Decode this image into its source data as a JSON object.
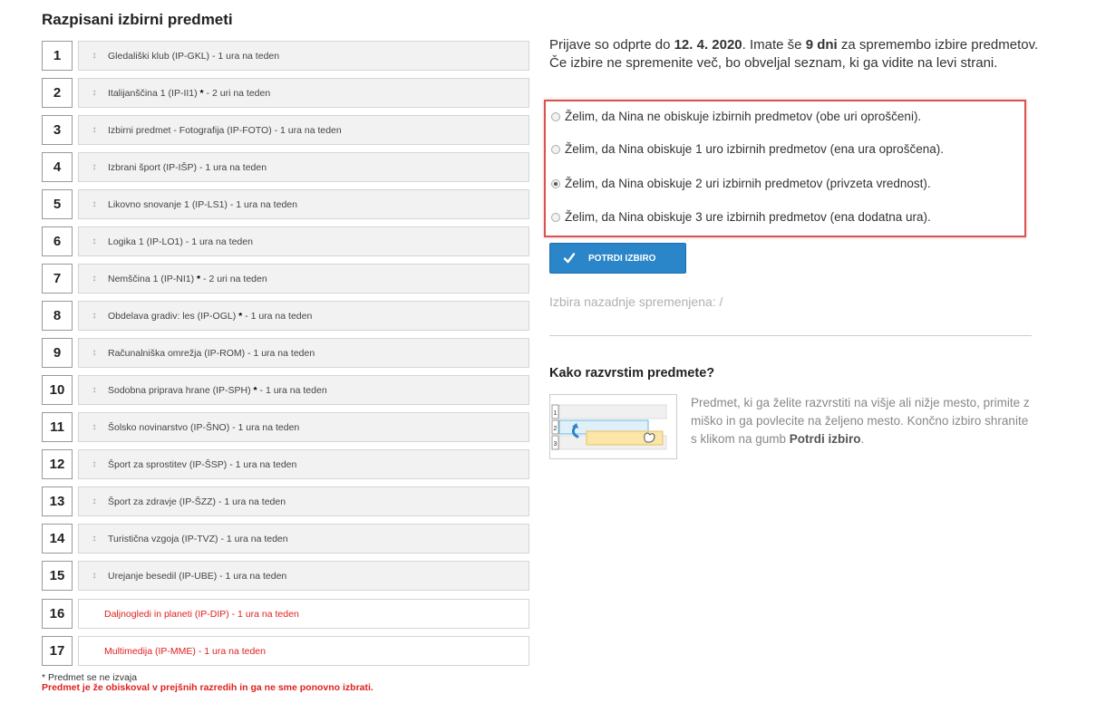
{
  "left": {
    "title": "Razpisani izbirni predmeti",
    "subjects": [
      {
        "num": "1",
        "label": "Gledališki klub (IP-GKL) - 1 ura na teden",
        "draggable": true
      },
      {
        "num": "2",
        "label_before_star": "Italijanščina 1 (IP-II1)",
        "star": "*",
        "label_after_star": " - 2 uri na teden",
        "draggable": true
      },
      {
        "num": "3",
        "label": "Izbirni predmet - Fotografija (IP-FOTO) - 1 ura na teden",
        "draggable": true
      },
      {
        "num": "4",
        "label": "Izbrani šport (IP-IŠP) - 1 ura na teden",
        "draggable": true
      },
      {
        "num": "5",
        "label": "Likovno snovanje 1 (IP-LS1) - 1 ura na teden",
        "draggable": true
      },
      {
        "num": "6",
        "label": "Logika 1 (IP-LO1) - 1 ura na teden",
        "draggable": true
      },
      {
        "num": "7",
        "label_before_star": "Nemščina 1 (IP-NI1)",
        "star": "*",
        "label_after_star": " - 2 uri na teden",
        "draggable": true
      },
      {
        "num": "8",
        "label_before_star": "Obdelava gradiv: les (IP-OGL)",
        "star": "*",
        "label_after_star": " - 1 ura na teden",
        "draggable": true
      },
      {
        "num": "9",
        "label": "Računalniška omrežja (IP-ROM) - 1 ura na teden",
        "draggable": true
      },
      {
        "num": "10",
        "label_before_star": "Sodobna priprava hrane (IP-SPH)",
        "star": "*",
        "label_after_star": " - 1 ura na teden",
        "draggable": true
      },
      {
        "num": "11",
        "label": "Šolsko novinarstvo (IP-ŠNO) - 1 ura na teden",
        "draggable": true
      },
      {
        "num": "12",
        "label": "Šport za sprostitev (IP-ŠSP) - 1 ura na teden",
        "draggable": true
      },
      {
        "num": "13",
        "label": "Šport za zdravje (IP-ŠZZ) - 1 ura na teden",
        "draggable": true
      },
      {
        "num": "14",
        "label": "Turistična vzgoja (IP-TVZ) - 1 ura na teden",
        "draggable": true
      },
      {
        "num": "15",
        "label": "Urejanje besedil (IP-UBE) - 1 ura na teden",
        "draggable": true
      },
      {
        "num": "16",
        "label": "Daljnogledi in planeti (IP-DIP) - 1 ura na teden",
        "draggable": false
      },
      {
        "num": "17",
        "label": "Multimedija (IP-MME) - 1 ura na teden",
        "draggable": false
      }
    ],
    "drag_icon": "↕",
    "footnote_star": "* Predmet se ne izvaja",
    "footnote_red": "Predmet je že obiskoval v prejšnih razredih in ga ne sme ponovno izbrati."
  },
  "right": {
    "info_part1": "Prijave so odprte do ",
    "info_date": "12. 4. 2020",
    "info_part2": ". Imate še ",
    "info_days": "9 dni",
    "info_part3": " za spremembo izbire predmetov. Če izbire ne spremenite več, bo obveljal seznam, ki ga vidite na levi strani.",
    "options": [
      {
        "label": "Želim, da Nina ne obiskuje izbirnih predmetov (obe uri oproščeni).",
        "checked": false
      },
      {
        "label": "Želim, da Nina obiskuje 1 uro izbirnih predmetov (ena ura oproščena).",
        "checked": false
      },
      {
        "label": "Želim, da Nina obiskuje 2 uri izbirnih predmetov (privzeta vrednost).",
        "checked": true
      },
      {
        "label": "Želim, da Nina obiskuje 3 ure izbirnih predmetov (ena dodatna ura).",
        "checked": false
      }
    ],
    "confirm_label": "POTRDI IZBIRO",
    "last_changed": "Izbira nazadnje spremenjena: /",
    "help_title": "Kako razvrstim predmete?",
    "help_text_1": "Predmet, ki ga želite razvrstiti na višje ali nižje mesto, primite z miško in ga povlecite na željeno mesto. Končno izbiro shranite s klikom na gumb ",
    "help_text_bold": "Potrdi izbiro",
    "help_text_2": ".",
    "help_figure_numbers": [
      "1",
      "2",
      "3"
    ]
  },
  "colors": {
    "accent_blue": "#2b86c9",
    "alert_red": "#e02020",
    "panel_border": "#d9534f"
  }
}
